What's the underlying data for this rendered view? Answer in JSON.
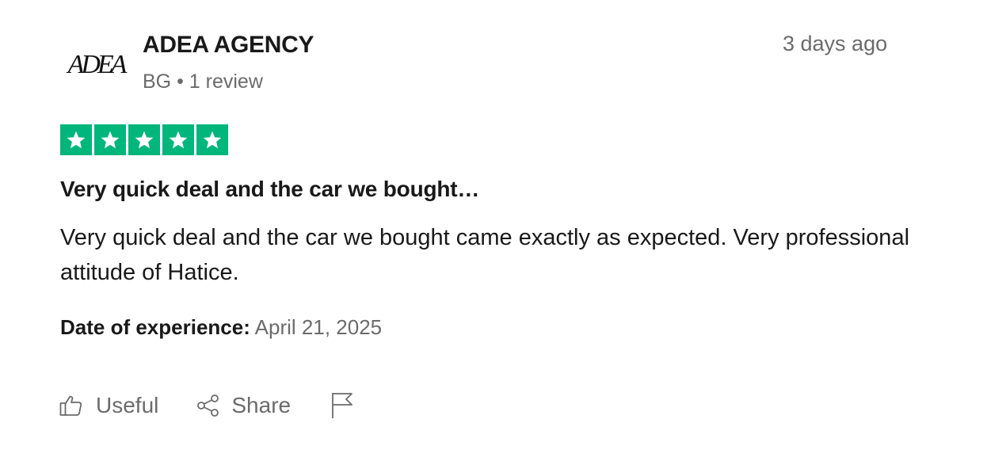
{
  "reviewer": {
    "name": "ADEA AGENCY",
    "country": "BG",
    "separator": "•",
    "review_count": "1 review",
    "avatar_text": "ADEA"
  },
  "review": {
    "posted": "3 days ago",
    "rating": 5,
    "rating_max": 5,
    "title": "Very quick deal and the car we bought…",
    "body": "Very quick deal and the car we bought came exactly as expected. Very professional attitude of Hatice.",
    "experience_label": "Date of experience:",
    "experience_date": "April 21, 2025"
  },
  "actions": {
    "useful_label": "Useful",
    "share_label": "Share"
  },
  "colors": {
    "star_green": "#00b67a",
    "muted_text": "#6b6b6b",
    "primary_text": "#191919"
  },
  "icons": [
    "adea-logo",
    "star-icon",
    "thumbs-up-icon",
    "share-icon",
    "flag-icon"
  ]
}
